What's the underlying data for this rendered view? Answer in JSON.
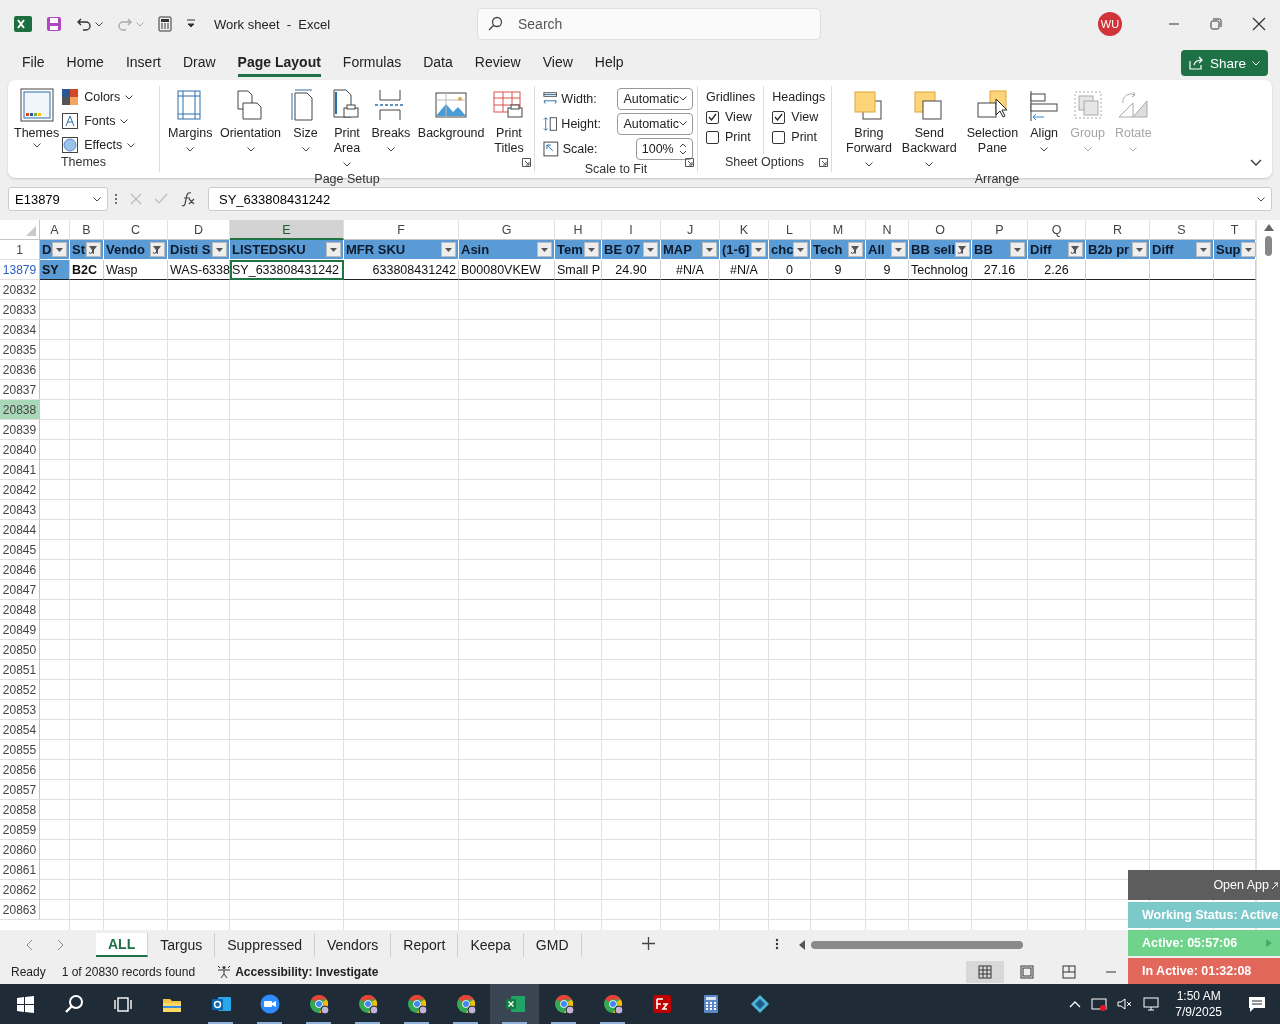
{
  "title_bar": {
    "title": "Work sheet  -  Excel",
    "search": {
      "placeholder": "Search"
    },
    "avatar": "WU"
  },
  "menu": [
    {
      "label": "File",
      "selected": false
    },
    {
      "label": "Home",
      "selected": false
    },
    {
      "label": "Insert",
      "selected": false
    },
    {
      "label": "Draw",
      "selected": false
    },
    {
      "label": "Page Layout",
      "selected": true
    },
    {
      "label": "Formulas",
      "selected": false
    },
    {
      "label": "Data",
      "selected": false
    },
    {
      "label": "Review",
      "selected": false
    },
    {
      "label": "View",
      "selected": false
    },
    {
      "label": "Help",
      "selected": false
    }
  ],
  "share_button": "Share",
  "ribbon": {
    "themes": {
      "label": "Themes",
      "main": "Themes",
      "small": [
        "Colors",
        "Fonts",
        "Effects"
      ]
    },
    "page_setup": {
      "label": "Page Setup",
      "buttons": [
        {
          "label": "Margins",
          "dropdown": true
        },
        {
          "label": "Orientation",
          "dropdown": true
        },
        {
          "label": "Size",
          "dropdown": true
        },
        {
          "label": "Print Area",
          "dropdown": true
        },
        {
          "label": "Breaks",
          "dropdown": true
        },
        {
          "label": "Background",
          "dropdown": false
        },
        {
          "label": "Print Titles",
          "dropdown": false
        }
      ]
    },
    "scale_to_fit": {
      "label": "Scale to Fit",
      "fields": [
        {
          "kind": "dropdown",
          "label": "Width:",
          "value": "Automatic"
        },
        {
          "kind": "dropdown",
          "label": "Height:",
          "value": "Automatic"
        },
        {
          "kind": "spin",
          "label": "Scale:",
          "value": "100%"
        }
      ]
    },
    "sheet_options": {
      "label": "Sheet Options",
      "sections": [
        {
          "title": "Gridlines",
          "options": [
            {
              "label": "View",
              "checked": true
            },
            {
              "label": "Print",
              "checked": false
            }
          ]
        },
        {
          "title": "Headings",
          "options": [
            {
              "label": "View",
              "checked": true
            },
            {
              "label": "Print",
              "checked": false
            }
          ]
        }
      ]
    },
    "arrange": {
      "label": "Arrange",
      "buttons": [
        {
          "label": "Bring Forward",
          "dropdown": true,
          "disabled": false
        },
        {
          "label": "Send Backward",
          "dropdown": true,
          "disabled": false
        },
        {
          "label": "Selection Pane",
          "dropdown": false,
          "disabled": false
        },
        {
          "label": "Align",
          "dropdown": true,
          "disabled": false
        },
        {
          "label": "Group",
          "dropdown": true,
          "disabled": true
        },
        {
          "label": "Rotate",
          "dropdown": true,
          "disabled": true
        }
      ]
    }
  },
  "formula_bar": {
    "name_box": "E13879",
    "formula": "SY_633808431242"
  },
  "sheet": {
    "columns": [
      {
        "letter": "A",
        "selected": false
      },
      {
        "letter": "B",
        "selected": false
      },
      {
        "letter": "C",
        "selected": false
      },
      {
        "letter": "D",
        "selected": false
      },
      {
        "letter": "E",
        "selected": true
      },
      {
        "letter": "F",
        "selected": false
      },
      {
        "letter": "G",
        "selected": false
      },
      {
        "letter": "H",
        "selected": false
      },
      {
        "letter": "I",
        "selected": false
      },
      {
        "letter": "J",
        "selected": false
      },
      {
        "letter": "K",
        "selected": false
      },
      {
        "letter": "L",
        "selected": false
      },
      {
        "letter": "M",
        "selected": false
      },
      {
        "letter": "N",
        "selected": false
      },
      {
        "letter": "O",
        "selected": false
      },
      {
        "letter": "P",
        "selected": false
      },
      {
        "letter": "Q",
        "selected": false
      },
      {
        "letter": "R",
        "selected": false
      },
      {
        "letter": "S",
        "selected": false
      },
      {
        "letter": "T",
        "selected": false
      }
    ],
    "header_row": {
      "number": "1",
      "cells": [
        {
          "text": "D",
          "filtered": false
        },
        {
          "text": "St",
          "filtered": true
        },
        {
          "text": "Vendo",
          "filtered": true
        },
        {
          "text": "Disti S",
          "filtered": false
        },
        {
          "text": "LISTEDSKU",
          "filtered": false
        },
        {
          "text": "MFR SKU",
          "filtered": false
        },
        {
          "text": "Asin",
          "filtered": false
        },
        {
          "text": "Tem",
          "filtered": false
        },
        {
          "text": "BE 07",
          "filtered": false
        },
        {
          "text": "MAP",
          "filtered": false
        },
        {
          "text": "(1-6]",
          "filtered": false
        },
        {
          "text": "chc",
          "filtered": false
        },
        {
          "text": "Tech",
          "filtered": true
        },
        {
          "text": "All",
          "filtered": false
        },
        {
          "text": "BB sell",
          "filtered": true
        },
        {
          "text": "BB",
          "filtered": false
        },
        {
          "text": "Diff",
          "filtered": true
        },
        {
          "text": "B2b pr",
          "filtered": false
        },
        {
          "text": "Diff",
          "filtered": false
        },
        {
          "text": "Sup",
          "filtered": false
        }
      ]
    },
    "data_row": {
      "number": "13879",
      "cells": [
        "SY",
        "B2C",
        "Wasp",
        "WAS-6338",
        "SY_633808431242",
        "633808431242",
        "B00080VKEW",
        "Small P",
        "24.90",
        "#N/A",
        "#N/A",
        "0",
        "9",
        "9",
        "Technolog",
        "27.16",
        "2.26"
      ]
    },
    "empty_rows": [
      {
        "number": "20832",
        "selected": false
      },
      {
        "number": "20833",
        "selected": false
      },
      {
        "number": "20834",
        "selected": false
      },
      {
        "number": "20835",
        "selected": false
      },
      {
        "number": "20836",
        "selected": false
      },
      {
        "number": "20837",
        "selected": false
      },
      {
        "number": "20838",
        "selected": true
      },
      {
        "number": "20839",
        "selected": false
      },
      {
        "number": "20840",
        "selected": false
      },
      {
        "number": "20841",
        "selected": false
      },
      {
        "number": "20842",
        "selected": false
      },
      {
        "number": "20843",
        "selected": false
      },
      {
        "number": "20844",
        "selected": false
      },
      {
        "number": "20845",
        "selected": false
      },
      {
        "number": "20846",
        "selected": false
      },
      {
        "number": "20847",
        "selected": false
      },
      {
        "number": "20848",
        "selected": false
      },
      {
        "number": "20849",
        "selected": false
      },
      {
        "number": "20850",
        "selected": false
      },
      {
        "number": "20851",
        "selected": false
      },
      {
        "number": "20852",
        "selected": false
      },
      {
        "number": "20853",
        "selected": false
      },
      {
        "number": "20854",
        "selected": false
      },
      {
        "number": "20855",
        "selected": false
      },
      {
        "number": "20856",
        "selected": false
      },
      {
        "number": "20857",
        "selected": false
      },
      {
        "number": "20858",
        "selected": false
      },
      {
        "number": "20859",
        "selected": false
      },
      {
        "number": "20860",
        "selected": false
      },
      {
        "number": "20861",
        "selected": false
      },
      {
        "number": "20862",
        "selected": false
      },
      {
        "number": "20863",
        "selected": false
      }
    ]
  },
  "sheet_tabs": [
    {
      "label": "ALL",
      "selected": true
    },
    {
      "label": "Targus",
      "selected": false
    },
    {
      "label": "Suppressed",
      "selected": false
    },
    {
      "label": "Vendors",
      "selected": false
    },
    {
      "label": "Report",
      "selected": false
    },
    {
      "label": "Keepa",
      "selected": false
    },
    {
      "label": "GMD",
      "selected": false
    }
  ],
  "status_bar": {
    "mode": "Ready",
    "records": "1 of 20830 records found",
    "accessibility": "Accessibility: Investigate",
    "views": [
      {
        "kind": "normal",
        "selected": true
      },
      {
        "kind": "page-layout",
        "selected": false
      },
      {
        "kind": "page-break",
        "selected": false
      }
    ]
  },
  "tracker": {
    "open_app": "Open App",
    "rows": [
      {
        "text": "Working Status: Active",
        "color": "#7cc9c9"
      },
      {
        "text": "Active: 05:57:06",
        "color": "#6fd38c"
      },
      {
        "text": "In Active: 01:32:08",
        "color": "#e2685c"
      }
    ]
  },
  "taskbar": {
    "apps": [
      {
        "kind": "start",
        "open": false,
        "selected": false
      },
      {
        "kind": "search",
        "open": false,
        "selected": false
      },
      {
        "kind": "taskview",
        "open": false,
        "selected": false
      },
      {
        "kind": "folder",
        "open": false,
        "selected": false
      },
      {
        "kind": "mail",
        "open": true,
        "selected": false
      },
      {
        "kind": "video",
        "open": true,
        "selected": false
      },
      {
        "kind": "browser",
        "open": true,
        "selected": false
      },
      {
        "kind": "browser",
        "open": true,
        "selected": false
      },
      {
        "kind": "browser",
        "open": true,
        "selected": false
      },
      {
        "kind": "browser",
        "open": true,
        "selected": false
      },
      {
        "kind": "sheet",
        "open": true,
        "selected": true
      },
      {
        "kind": "browser",
        "open": true,
        "selected": false
      },
      {
        "kind": "browser",
        "open": true,
        "selected": false
      },
      {
        "kind": "ftp",
        "open": false,
        "selected": false
      },
      {
        "kind": "calculator",
        "open": false,
        "selected": false
      },
      {
        "kind": "diamond",
        "open": false,
        "selected": false
      }
    ],
    "time": "1:50 AM",
    "date": "7/9/2025"
  }
}
